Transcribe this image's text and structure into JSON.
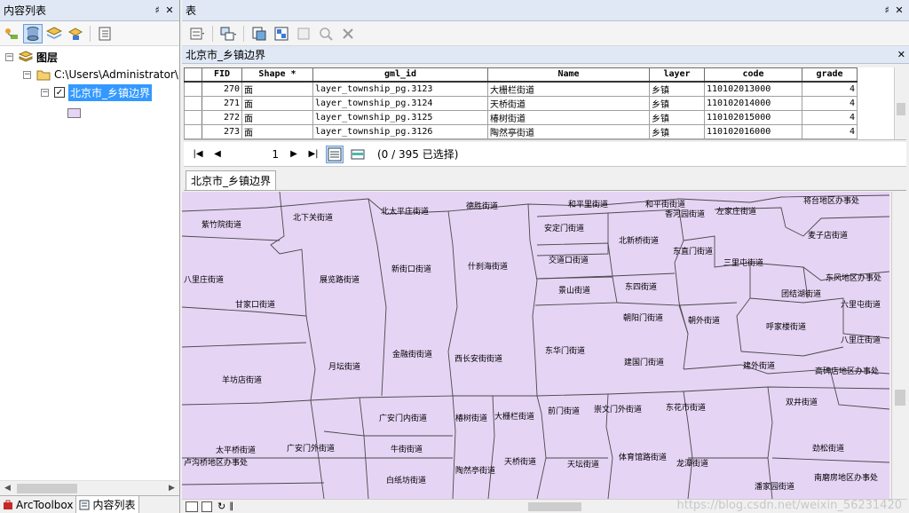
{
  "toc": {
    "title": "内容列表",
    "pin": "♯",
    "close": "✕",
    "root_label": "图层",
    "folder_label": "C:\\Users\\Administrator\\",
    "layer_label": "北京市_乡镇边界",
    "tabs": [
      "ArcToolbox",
      "内容列表"
    ]
  },
  "table_window": {
    "title": "表",
    "pin": "♯",
    "close": "✕",
    "layer_name": "北京市_乡镇边界",
    "columns": [
      "FID",
      "Shape *",
      "gml_id",
      "Name",
      "layer",
      "code",
      "grade"
    ],
    "rows": [
      [
        "270",
        "面",
        "layer_township_pg.3123",
        "大栅栏街道",
        "乡镇",
        "110102013000",
        "4"
      ],
      [
        "271",
        "面",
        "layer_township_pg.3124",
        "天桥街道",
        "乡镇",
        "110102014000",
        "4"
      ],
      [
        "272",
        "面",
        "layer_township_pg.3125",
        "椿树街道",
        "乡镇",
        "110102015000",
        "4"
      ],
      [
        "273",
        "面",
        "layer_township_pg.3126",
        "陶然亭街道",
        "乡镇",
        "110102016000",
        "4"
      ]
    ],
    "record_value": "1",
    "selection_status": "(0 / 395 已选择)",
    "tab_label": "北京市_乡镇边界"
  },
  "map": {
    "fill_color": "#e6d4f5",
    "line_color": "#4a4a4a",
    "labels": [
      "紫竹院街道",
      "北下关街道",
      "北太平庄街道",
      "德胜街道",
      "和平里街道",
      "和平街街道",
      "香河园街道",
      "左家庄街道",
      "将台地区办事处",
      "安定门街道",
      "北新桥街道",
      "东直门街道",
      "麦子店街道",
      "交道口街道",
      "三里屯街道",
      "八里庄街道",
      "展览路街道",
      "新街口街道",
      "什刹海街道",
      "景山街道",
      "东四街道",
      "东风地区办事处",
      "团结湖街道",
      "甘家口街道",
      "六里屯街道",
      "朝阳门街道",
      "朝外街道",
      "呼家楼街道",
      "八里庄街道",
      "金融街街道",
      "西长安街街道",
      "东华门街道",
      "月坛街道",
      "建国门街道",
      "建外街道",
      "高碑店地区办事处",
      "羊坊店街道",
      "双井街道",
      "广安门内街道",
      "椿树街道",
      "大栅栏街道",
      "前门街道",
      "崇文门外街道",
      "东花市街道",
      "太平桥街道",
      "广安门外街道",
      "牛街街道",
      "劲松街道",
      "卢沟桥地区办事处",
      "白纸坊街道",
      "陶然亭街道",
      "天桥街道",
      "天坛街道",
      "体育馆路街道",
      "龙潭街道",
      "潘家园街道",
      "南磨房地区办事处"
    ]
  },
  "watermark": "https://blog.csdn.net/weixin_56231420"
}
